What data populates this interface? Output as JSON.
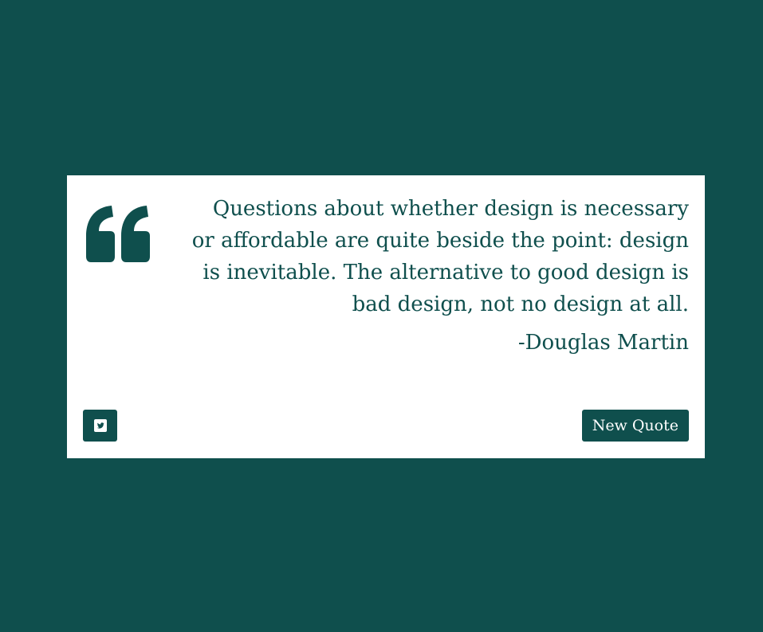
{
  "quote": {
    "text": "Questions about whether design is necessary or affordable are quite beside the point: design is inevitable. The alternative to good design is bad design, not no design at all.",
    "author": "-Douglas Martin"
  },
  "actions": {
    "tweet_icon": "twitter-icon",
    "new_quote_label": "New Quote"
  },
  "theme": {
    "background": "#0f4f4d",
    "card": "#ffffff",
    "accent": "#0f4f4d"
  }
}
